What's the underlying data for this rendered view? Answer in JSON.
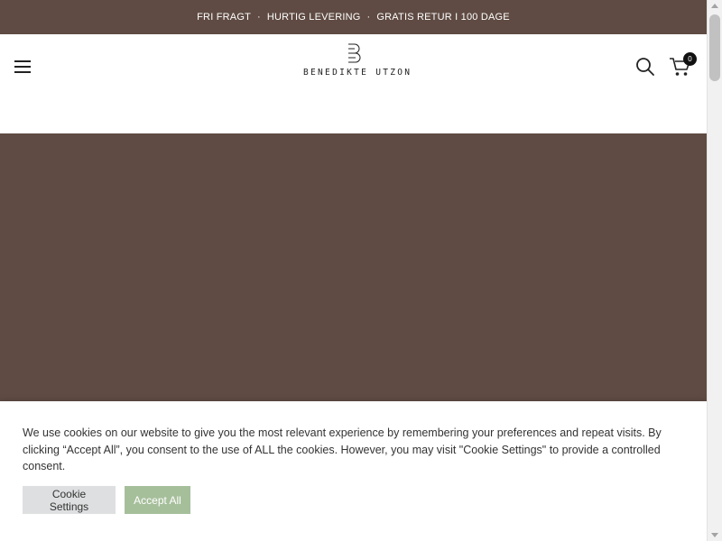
{
  "announcement": {
    "items": [
      "FRI FRAGT",
      "HURTIG LEVERING",
      "GRATIS RETUR I 100 DAGE"
    ],
    "separator": "·"
  },
  "header": {
    "brand": "BENEDIKTE UTZON",
    "cart_count": "0",
    "icons": [
      "menu-icon",
      "logo-mark-icon",
      "search-icon",
      "cart-icon"
    ]
  },
  "cookie_banner": {
    "text": "We use cookies on our website to give you the most relevant experience by remembering your preferences and repeat visits. By clicking “Accept All”, you consent to the use of ALL the cookies. However, you may visit \"Cookie Settings\" to provide a controlled consent.",
    "settings_label": "Cookie Settings",
    "accept_label": "Accept All"
  },
  "colors": {
    "brand_brown": "#5f4b43",
    "accept_green": "#a6bf9b",
    "settings_gray": "#dedfe0"
  }
}
